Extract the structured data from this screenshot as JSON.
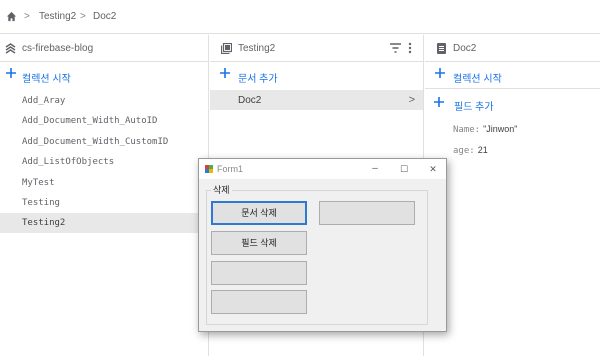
{
  "breadcrumb": {
    "items": [
      "Testing2",
      "Doc2"
    ]
  },
  "collections_panel": {
    "project_name": "cs-firebase-blog",
    "add_label": "컬렉션 시작",
    "items": [
      "Add_Aray",
      "Add_Document_Width_AutoID",
      "Add_Document_Width_CustomID",
      "Add_ListOfObjects",
      "MyTest",
      "Testing",
      "Testing2"
    ],
    "selected": "Testing2"
  },
  "documents_panel": {
    "title": "Testing2",
    "add_label": "문서 추가",
    "items": [
      "Doc2"
    ]
  },
  "fields_panel": {
    "title": "Doc2",
    "start_collection_label": "컬렉션 시작",
    "add_field_label": "필드 추가",
    "fields": [
      {
        "key": "Name:",
        "value": "\"Jinwon\""
      },
      {
        "key": "age:",
        "value": "21"
      }
    ]
  },
  "form": {
    "title": "Form1",
    "group_label": "삭제",
    "buttons": [
      "문서 삭제",
      "필드 삭제",
      "",
      "",
      ""
    ],
    "minimize": "–",
    "maximize": "☐",
    "close": "✕"
  },
  "colors": {
    "accent": "#1a73e8",
    "selected_bg": "#e8e8e8",
    "form_bg": "#f0f0f0",
    "focus_border": "#2f79d0"
  },
  "icons": [
    "home-icon",
    "chevron-right-icon",
    "firebase-icon",
    "document-stack-icon",
    "filter-icon",
    "more-vert-icon",
    "document-icon",
    "plus-icon",
    "form-app-icon"
  ]
}
